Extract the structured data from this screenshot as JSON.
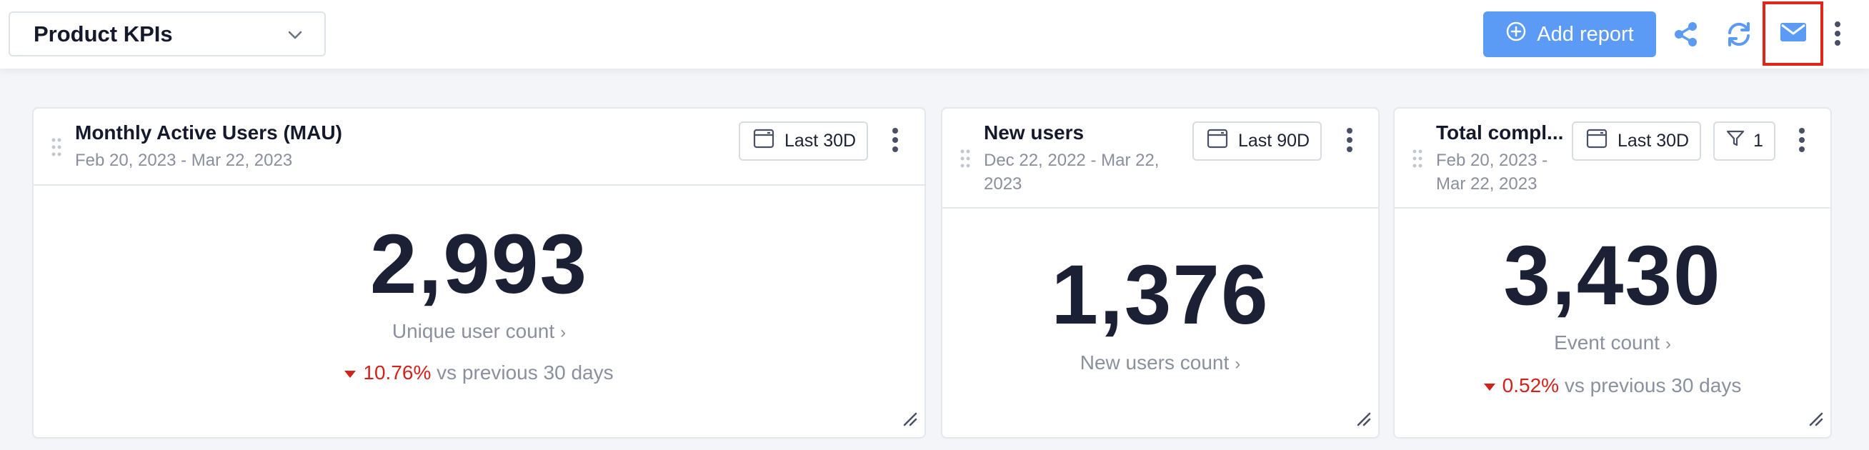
{
  "dashboard": {
    "title": "Product KPIs"
  },
  "toolbar": {
    "add_report_label": "Add report"
  },
  "cards": [
    {
      "title": "Monthly Active Users (MAU)",
      "date_range": "Feb 20, 2023 - Mar 22, 2023",
      "range_label": "Last 30D",
      "value": "2,993",
      "metric_label": "Unique user count",
      "delta_pct": "10.76%",
      "delta_text": "vs previous 30 days"
    },
    {
      "title": "New users",
      "date_range_line1": "Dec 22, 2022 - Mar 22,",
      "date_range_line2": "2023",
      "range_label": "Last 90D",
      "value": "1,376",
      "metric_label": "New users count"
    },
    {
      "title": "Total compl...",
      "date_range_line1": "Feb 20, 2023 -",
      "date_range_line2": "Mar 22, 2023",
      "range_label": "Last 30D",
      "filter_count": "1",
      "value": "3,430",
      "metric_label": "Event count",
      "delta_pct": "0.52%",
      "delta_text": "vs previous 30 days"
    }
  ],
  "colors": {
    "accent": "#5b9af5",
    "negative": "#d0231b",
    "highlight": "#e0251b"
  }
}
